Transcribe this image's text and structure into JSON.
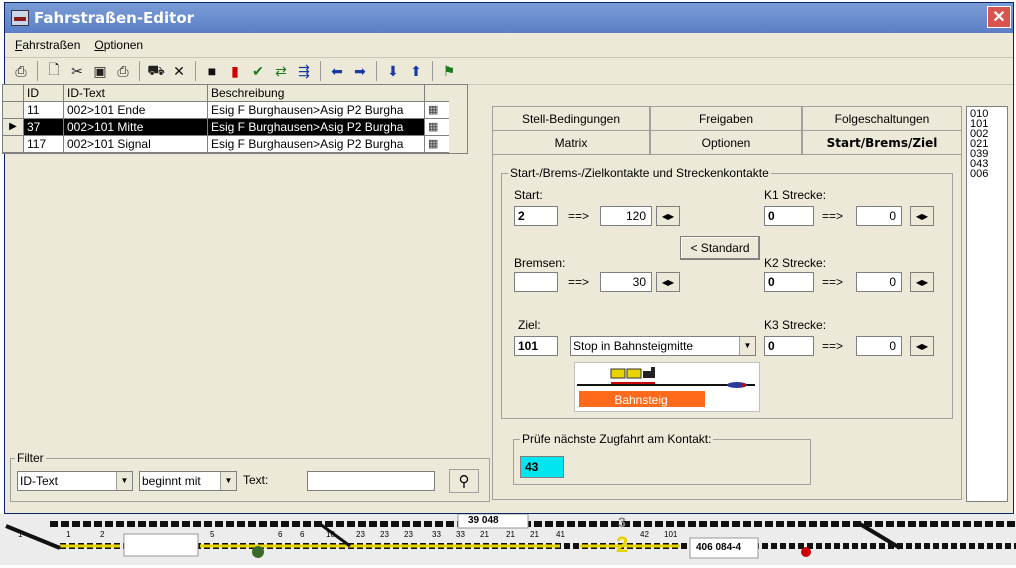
{
  "window": {
    "title": "Fahrstraßen-Editor",
    "close_symbol": "✕"
  },
  "menu": [
    "Fahrstraßen",
    "Optionen"
  ],
  "toolbar_icons": [
    "select-icon",
    "new-icon",
    "cut-icon",
    "save-icon",
    "print-icon",
    "car-icon",
    "delete-icon",
    "record-icon",
    "stop-icon",
    "check-icon",
    "swap-icon",
    "calculate-icon",
    "arrow-left-icon",
    "arrow-right-icon",
    "arrow-down-icon",
    "arrow-up-icon",
    "signal-icon"
  ],
  "grid": {
    "headers": [
      "ID",
      "ID-Text",
      "Beschreibung"
    ],
    "rows": [
      {
        "id": "11",
        "text": "002>101 Ende",
        "desc": "Esig F Burghausen>Asig P2 Burgha",
        "selected": false
      },
      {
        "id": "37",
        "text": "002>101 Mitte",
        "desc": "Esig F Burghausen>Asig P2 Burgha",
        "selected": true
      },
      {
        "id": "117",
        "text": "002>101 Signal",
        "desc": "Esig F Burghausen>Asig P2 Burgha",
        "selected": false
      }
    ]
  },
  "filter": {
    "legend": "Filter",
    "field": "ID-Text",
    "mode": "beginnt mit",
    "text_label": "Text:",
    "text_value": ""
  },
  "tabs": {
    "row1": [
      {
        "label": "Stell-Bedingungen"
      },
      {
        "label": "Freigaben"
      },
      {
        "label": "Folgeschaltungen"
      }
    ],
    "row2": [
      {
        "label": "Matrix"
      },
      {
        "label": "Optionen"
      },
      {
        "label": "Start/Brems/Ziel"
      }
    ]
  },
  "kontakte": {
    "legend": "Start-/Brems-/Zielkontakte und Streckenkontakte",
    "start_label": "Start:",
    "start_value": "2",
    "start_arrow": "==>",
    "start_dist": "120",
    "k1_label": "K1 Strecke:",
    "k1_value": "0",
    "k1_arrow": "==>",
    "k1_dist": "0",
    "standard_button": "< Standard",
    "brems_label": "Bremsen:",
    "brems_value": "",
    "brems_arrow": "==>",
    "brems_dist": "30",
    "k2_label": "K2 Strecke:",
    "k2_value": "0",
    "k2_arrow": "==>",
    "k2_dist": "0",
    "ziel_label": "Ziel:",
    "ziel_value": "101",
    "ziel_option": "Stop in Bahnsteigmitte",
    "k3_label": "K3 Strecke:",
    "k3_value": "0",
    "k3_arrow": "==>",
    "k3_dist": "0",
    "platform_label": "Bahnsteig",
    "pruefe_legend": "Prüfe nächste Zugfahrt am Kontakt:",
    "pruefe_value": "43"
  },
  "id_list": [
    "010",
    "101",
    "002",
    "021",
    "039",
    "043",
    "006"
  ],
  "track": {
    "numbers_top": [
      "1",
      "1",
      "2",
      "5",
      "6",
      "6",
      "10",
      "23",
      "23",
      "23",
      "33",
      "33",
      "21",
      "21",
      "21",
      "41",
      "42",
      "101"
    ],
    "loco_label_1": "39 048",
    "loco_label_2": "406 084-4",
    "big_number": "2",
    "big_number_2": "3"
  },
  "colors": {
    "selection": "#000000",
    "accent_cyan": "#00e5f0",
    "platform": "#ff6a1a",
    "track_yellow": "#e8d400",
    "title_blue": "#5b7fc6"
  }
}
